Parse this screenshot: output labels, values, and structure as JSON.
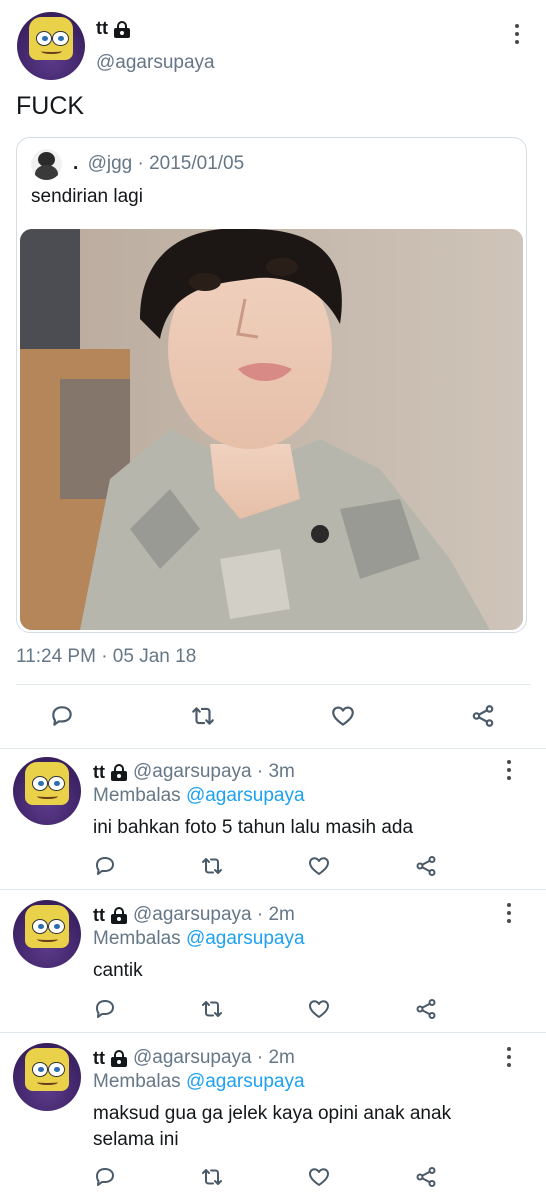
{
  "main_tweet": {
    "display_name": "tt",
    "handle": "@agarsupaya",
    "text": "FUCK",
    "timestamp": "11:24 PM · 05 Jan 18",
    "quoted": {
      "display_name": ".",
      "handle_date": "@jgg · 2015/01/05",
      "text": "sendirian lagi"
    }
  },
  "replies": [
    {
      "display_name": "tt",
      "meta": "@agarsupaya · 3m",
      "replying_prefix": "Membalas",
      "replying_to": "@agarsupaya",
      "text": "ini bahkan foto 5 tahun lalu masih ada"
    },
    {
      "display_name": "tt",
      "meta": "@agarsupaya · 2m",
      "replying_prefix": "Membalas",
      "replying_to": "@agarsupaya",
      "text": "cantik"
    },
    {
      "display_name": "tt",
      "meta": "@agarsupaya · 2m",
      "replying_prefix": "Membalas",
      "replying_to": "@agarsupaya",
      "text": "maksud gua ga jelek kaya opini anak anak selama ini"
    }
  ],
  "icons": [
    "reply-icon",
    "retweet-icon",
    "like-icon",
    "share-icon",
    "more-icon",
    "lock-icon"
  ],
  "colors": {
    "link": "#1da1f2",
    "muted": "#657786",
    "text": "#14171a",
    "divider": "#e1e8ed"
  }
}
